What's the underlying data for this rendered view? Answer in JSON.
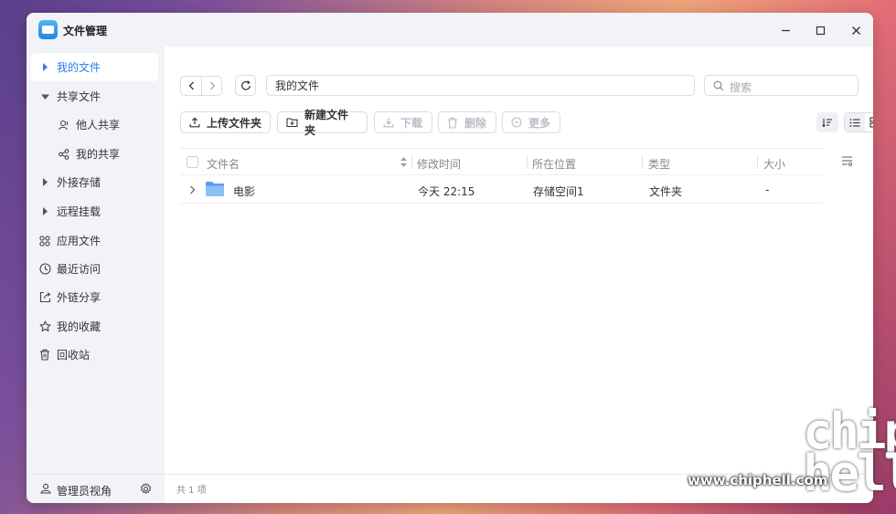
{
  "app": {
    "title": "文件管理"
  },
  "sidebar": {
    "items": [
      {
        "label": "我的文件",
        "icon": "caret-right-icon",
        "active": true
      },
      {
        "label": "共享文件",
        "icon": "caret-down-icon"
      },
      {
        "label": "他人共享",
        "icon": "user-share-icon"
      },
      {
        "label": "我的共享",
        "icon": "share-icon"
      },
      {
        "label": "外接存储",
        "icon": "caret-right-icon"
      },
      {
        "label": "远程挂载",
        "icon": "caret-right-icon"
      },
      {
        "label": "应用文件",
        "icon": "apps-icon"
      },
      {
        "label": "最近访问",
        "icon": "clock-icon"
      },
      {
        "label": "外链分享",
        "icon": "external-share-icon"
      },
      {
        "label": "我的收藏",
        "icon": "star-icon"
      },
      {
        "label": "回收站",
        "icon": "trash-icon"
      }
    ],
    "footer_label": "管理员视角"
  },
  "nav": {
    "path": "我的文件",
    "search_placeholder": "搜索"
  },
  "toolbar": {
    "upload_label": "上传文件夹",
    "new_folder_label": "新建文件夹",
    "download_label": "下载",
    "delete_label": "删除",
    "more_label": "更多"
  },
  "table": {
    "headers": {
      "name": "文件名",
      "modified": "修改时间",
      "location": "所在位置",
      "type": "类型",
      "size": "大小"
    },
    "rows": [
      {
        "name": "电影",
        "modified": "今天 22:15",
        "location": "存储空间1",
        "type": "文件夹",
        "size": "-"
      }
    ]
  },
  "status": {
    "count_text": "共 1 项"
  },
  "watermark": {
    "site": "www.chiphell.com",
    "logo": "chip hell"
  },
  "colors": {
    "accent": "#2f7de8",
    "folder": "#6aa9f0"
  }
}
